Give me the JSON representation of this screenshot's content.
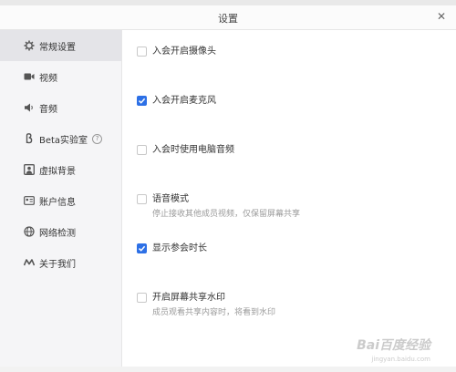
{
  "window": {
    "title": "设置"
  },
  "sidebar": {
    "items": [
      {
        "label": "常规设置",
        "icon": "gear-icon",
        "active": true
      },
      {
        "label": "视频",
        "icon": "video-camera-icon"
      },
      {
        "label": "音频",
        "icon": "speaker-icon"
      },
      {
        "label": "Beta实验室",
        "icon": "beta-lab-icon",
        "help": "?"
      },
      {
        "label": "虚拟背景",
        "icon": "person-frame-icon"
      },
      {
        "label": "账户信息",
        "icon": "id-card-icon"
      },
      {
        "label": "网络检测",
        "icon": "globe-icon"
      },
      {
        "label": "关于我们",
        "icon": "logo-mark-icon"
      }
    ]
  },
  "settings": {
    "options": [
      {
        "label": "入会开启摄像头",
        "checked": false
      },
      {
        "label": "入会开启麦克风",
        "checked": true
      },
      {
        "label": "入会时使用电脑音频",
        "checked": false
      },
      {
        "label": "语音模式",
        "desc": "停止接收其他成员视频，仅保留屏幕共享",
        "checked": false
      },
      {
        "label": "显示参会时长",
        "checked": true
      },
      {
        "label": "开启屏幕共享水印",
        "desc": "成员观看共享内容时，将看到水印",
        "checked": false
      }
    ]
  },
  "watermark": {
    "text": "Bai百度经验",
    "sub": "jingyan.baidu.com"
  },
  "colors": {
    "accent": "#2d70e6",
    "sidebar_bg": "#f5f5f7",
    "active_bg": "#e4e4e8"
  }
}
